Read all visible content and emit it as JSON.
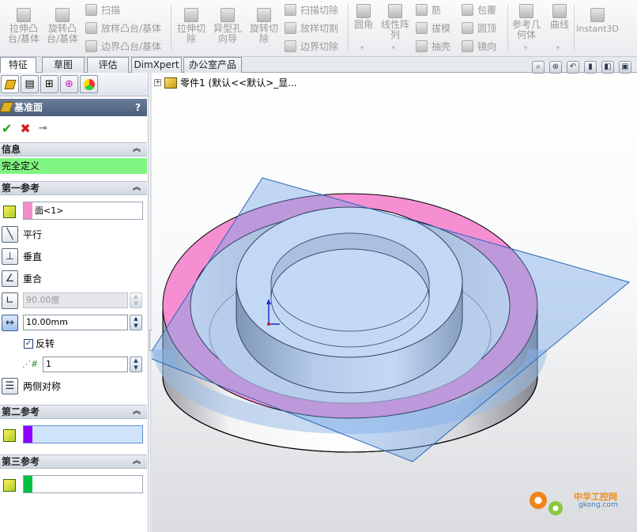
{
  "ribbon": {
    "btn_extrude_boss": "拉伸凸\n台/基体",
    "btn_revolve_boss": "旋转凸\n台/基体",
    "btn_sweep": "扫描",
    "btn_loft": "放样凸台/基体",
    "btn_boundary": "边界凸台/基体",
    "btn_extrude_cut": "拉伸切\n除",
    "btn_hole": "异型孔\n向导",
    "btn_revolve_cut": "旋转切\n除",
    "btn_sweep_cut": "扫描切除",
    "btn_loft_cut": "放样切割",
    "btn_boundary_cut": "边界切除",
    "btn_fillet": "圆角",
    "btn_pattern": "线性阵\n列",
    "btn_rib": "筋",
    "btn_draft": "拔模",
    "btn_shell": "抽壳",
    "btn_wrap": "包覆",
    "btn_dome": "圆顶",
    "btn_mirror": "镜向",
    "btn_refgeom": "参考几\n何体",
    "btn_curves": "曲线",
    "btn_instant3d": "Instant3D"
  },
  "tabs": [
    "特征",
    "草图",
    "评估",
    "DimXpert",
    "办公室产品"
  ],
  "pm": {
    "title": "基准面",
    "help": "?",
    "info_header": "信息",
    "status": "完全定义",
    "first_ref_header": "第一参考",
    "first_ref_value": "面<1>",
    "first_ref_color": "#f48cc8",
    "opt_parallel": "平行",
    "opt_perpendicular": "垂直",
    "opt_coincident": "重合",
    "angle_value": "90.00度",
    "distance_value": "10.00mm",
    "flip_label": "反转",
    "flip_checked": true,
    "count_value": "1",
    "opt_midplane": "两侧对称",
    "second_ref_header": "第二参考",
    "second_ref_color": "#8b00ff",
    "third_ref_header": "第三参考",
    "third_ref_color": "#00c040"
  },
  "tree": {
    "node": "零件1  (默认<<默认>_显..."
  },
  "watermark": {
    "title": "中华工控网",
    "url": "gkong.com"
  }
}
